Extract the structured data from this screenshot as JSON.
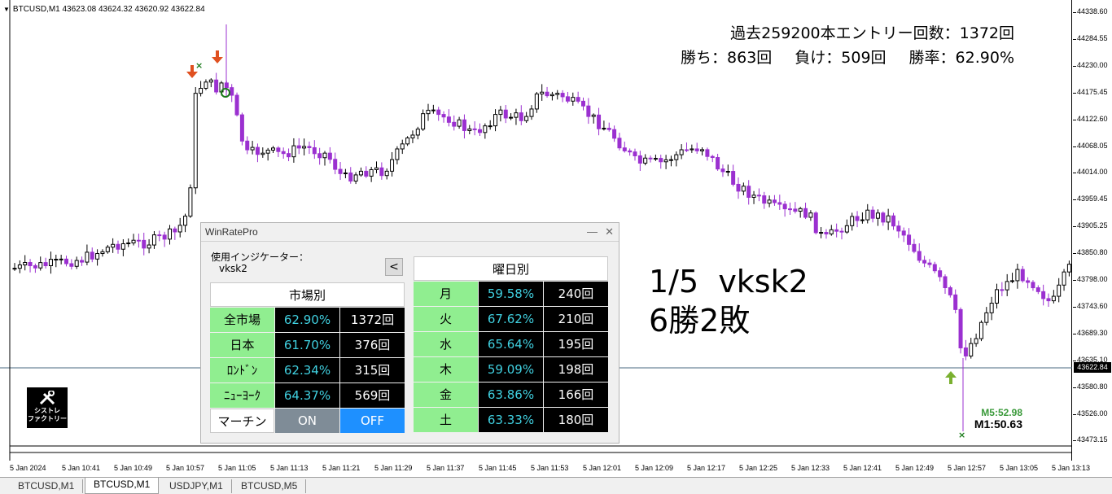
{
  "chart": {
    "header": "BTCUSD,M1  43623.08 43624.32 43620.92 43622.84",
    "stats_line1": "過去259200本エントリー回数：1372回",
    "stats_wins": "勝ち：863回",
    "stats_losses": "負け：509回",
    "stats_rate": "勝率：62.90%",
    "overlay_line1": "1/5  vksk2",
    "overlay_line2": "6勝2敗",
    "logo_line1": "シストレ",
    "logo_line2": "ファクトリー",
    "timer_m5": "M5:52.98",
    "timer_m1": "M1:50.63",
    "current_price": "43622.84",
    "price_labels": [
      "44338.60",
      "44284.55",
      "44230.00",
      "44175.45",
      "44122.60",
      "44068.05",
      "44014.00",
      "43959.45",
      "43905.25",
      "43850.80",
      "43798.00",
      "43743.60",
      "43689.30",
      "43635.10",
      "43580.80",
      "43526.00",
      "43473.15"
    ],
    "time_labels": [
      "5 Jan 2024",
      "5 Jan 10:41",
      "5 Jan 10:49",
      "5 Jan 10:57",
      "5 Jan 11:05",
      "5 Jan 11:13",
      "5 Jan 11:21",
      "5 Jan 11:29",
      "5 Jan 11:37",
      "5 Jan 11:45",
      "5 Jan 11:53",
      "5 Jan 12:01",
      "5 Jan 12:09",
      "5 Jan 12:17",
      "5 Jan 12:25",
      "5 Jan 12:33",
      "5 Jan 12:41",
      "5 Jan 12:49",
      "5 Jan 12:57",
      "5 Jan 13:05",
      "5 Jan 13:13"
    ],
    "colors": {
      "bull": "#ffffff",
      "bear": "#9b30d0",
      "outline": "#000000",
      "sell_arrow": "#e05020",
      "buy_arrow": "#7ab030",
      "win_mark": "#1a7a1a"
    }
  },
  "tabs": [
    "BTCUSD,M1",
    "BTCUSD,M1",
    "USDJPY,M1",
    "BTCUSD,M5"
  ],
  "active_tab": 1,
  "panel": {
    "title": "WinRatePro",
    "indicator_label": "使用インジケーター：",
    "indicator_name": "vksk2",
    "collapse_label": "<",
    "market_header": "市場別",
    "markets": [
      {
        "label": "全市場",
        "pct": "62.90%",
        "count": "1372回"
      },
      {
        "label": "日本",
        "pct": "61.70%",
        "count": "376回"
      },
      {
        "label": "ﾛﾝﾄﾞﾝ",
        "pct": "62.34%",
        "count": "315回"
      },
      {
        "label": "ﾆｭｰﾖｰｸ",
        "pct": "64.37%",
        "count": "569回"
      }
    ],
    "martin_label": "マーチン",
    "on_label": "ON",
    "off_label": "OFF",
    "weekday_header": "曜日別",
    "weekdays": [
      {
        "label": "月",
        "pct": "59.58%",
        "count": "240回"
      },
      {
        "label": "火",
        "pct": "67.62%",
        "count": "210回"
      },
      {
        "label": "水",
        "pct": "65.64%",
        "count": "195回"
      },
      {
        "label": "木",
        "pct": "59.09%",
        "count": "198回"
      },
      {
        "label": "金",
        "pct": "63.86%",
        "count": "166回"
      },
      {
        "label": "土",
        "pct": "63.33%",
        "count": "180回"
      }
    ]
  }
}
